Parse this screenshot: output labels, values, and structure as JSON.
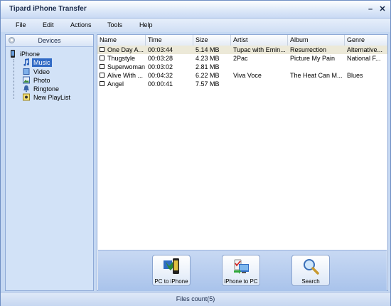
{
  "window": {
    "title": "Tipard iPhone Transfer"
  },
  "menu": [
    "File",
    "Edit",
    "Actions",
    "Tools",
    "Help"
  ],
  "sidebar": {
    "header": "Devices",
    "device": "iPhone",
    "items": [
      {
        "label": "Music",
        "icon": "music-note-icon"
      },
      {
        "label": "Video",
        "icon": "video-icon"
      },
      {
        "label": "Photo",
        "icon": "photo-icon"
      },
      {
        "label": "Ringtone",
        "icon": "bell-icon"
      },
      {
        "label": "New PlayList",
        "icon": "playlist-icon"
      }
    ]
  },
  "table": {
    "columns": [
      "Name",
      "Time",
      "Size",
      "Artist",
      "Album",
      "Genre"
    ],
    "rows": [
      [
        "One Day A...",
        "00:03:44",
        "5.14 MB",
        "Tupac with Emin...",
        "Resurrection",
        "Alternative..."
      ],
      [
        "Thugstyle",
        "00:03:28",
        "4.23 MB",
        "2Pac",
        "Picture My Pain",
        "National F..."
      ],
      [
        "Superwoman",
        "00:03:02",
        "2.81 MB",
        "",
        "",
        ""
      ],
      [
        "Alive With ...",
        "00:04:32",
        "6.22 MB",
        "Viva Voce",
        "The Heat Can M...",
        "Blues"
      ],
      [
        "Angel",
        "00:00:41",
        "7.57 MB",
        "",
        "",
        ""
      ]
    ]
  },
  "toolbar": {
    "pc_to_iphone": "PC to iPhone",
    "iphone_to_pc": "iPhone to PC",
    "search": "Search"
  },
  "status": {
    "files_count": "Files count(5)"
  }
}
